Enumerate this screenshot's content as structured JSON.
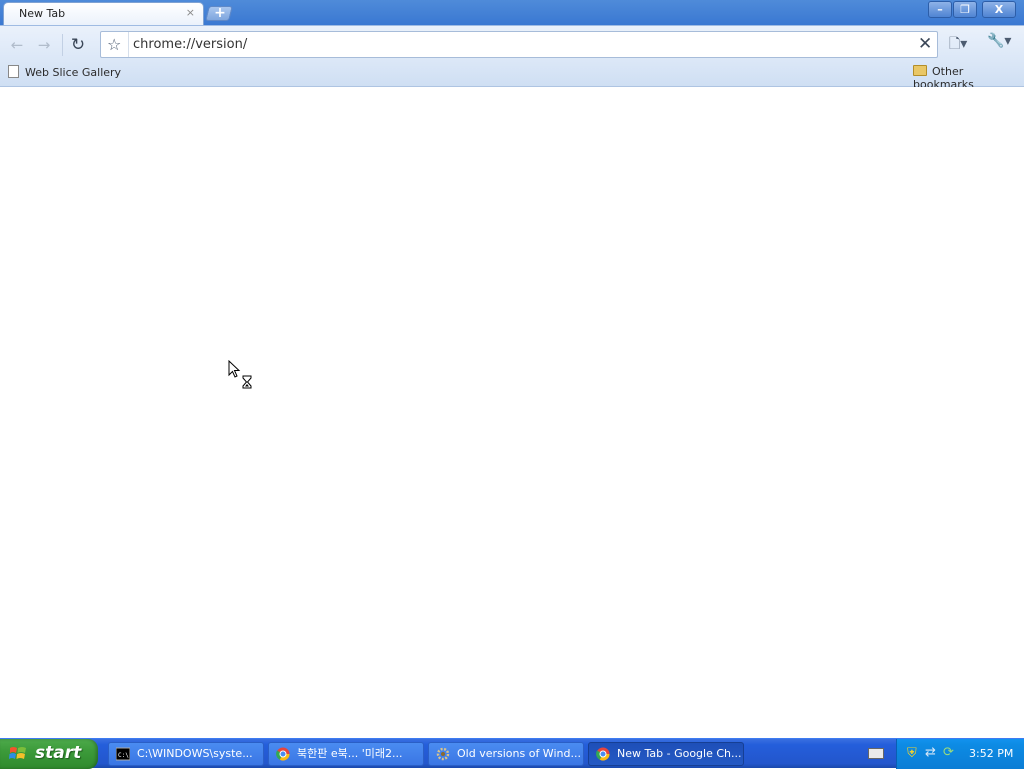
{
  "browser": {
    "tab": {
      "title": "New Tab",
      "close_glyph": "×"
    },
    "new_tab_glyph": "+",
    "window_buttons": {
      "minimize": "–",
      "maximize": "❐",
      "close": "X"
    },
    "toolbar": {
      "back_glyph": "←",
      "forward_glyph": "→",
      "reload_glyph": "↻",
      "star_glyph": "☆",
      "url": "chrome://version/",
      "stop_glyph": "✕",
      "page_menu_glyph": "🗋▾",
      "wrench_glyph": "🔧▾"
    },
    "bookmarks": {
      "items": [
        {
          "label": "Web Slice Gallery",
          "icon": "page-icon"
        }
      ],
      "other": {
        "label": "Other bookmarks",
        "icon": "folder-icon"
      }
    }
  },
  "taskbar": {
    "start_label": "start",
    "tasks": [
      {
        "label": "C:\\WINDOWS\\syste...",
        "icon": "cmd-icon",
        "active": false
      },
      {
        "label": "북한판 e북... '미래2...",
        "icon": "chrome-icon",
        "active": false
      },
      {
        "label": "Old versions of Wind...",
        "icon": "gear-icon",
        "active": false
      },
      {
        "label": "New Tab - Google Ch...",
        "icon": "chrome-icon",
        "active": true
      }
    ],
    "tray": {
      "shield_glyph": "⛨",
      "network_glyph": "⇄",
      "update_glyph": "⟳",
      "clock": "3:52 PM"
    }
  },
  "colors": {
    "titlebar": "#3a78d2",
    "taskbar": "#245edb",
    "start": "#3c9a3a",
    "tray": "#0d8be4"
  }
}
